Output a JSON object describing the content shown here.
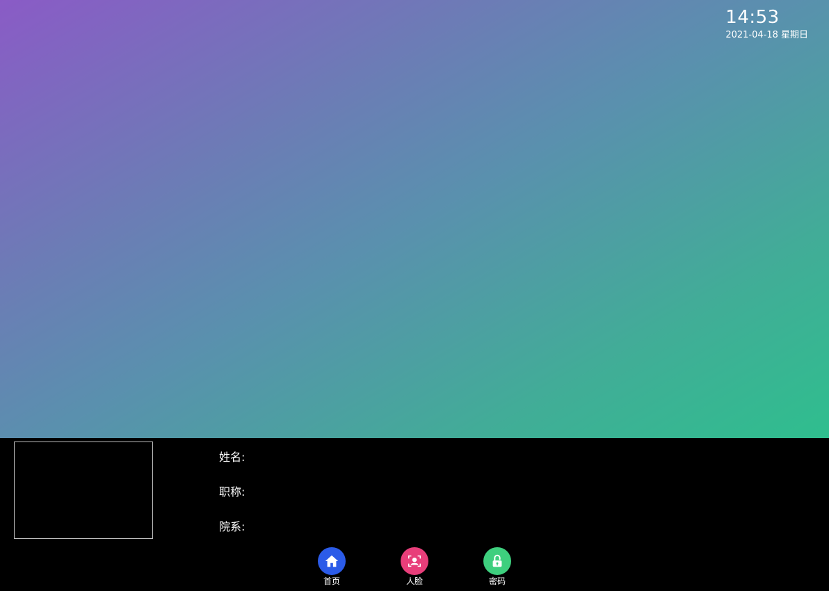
{
  "clock": {
    "time": "14:53",
    "date": "2021-04-18 星期日"
  },
  "info": {
    "name_label": "姓名:",
    "title_label": "职称:",
    "dept_label": "院系:"
  },
  "nav": [
    {
      "label": "首页",
      "icon": "home-icon",
      "color": "#2b5be8"
    },
    {
      "label": "人脸",
      "icon": "face-icon",
      "color": "#e83e7a"
    },
    {
      "label": "密码",
      "icon": "lock-icon",
      "color": "#3ecf7e"
    }
  ],
  "colors": {
    "gradient_start": "#8a5bc6",
    "gradient_end": "#2fbe8e",
    "panel_bg": "#000000"
  }
}
